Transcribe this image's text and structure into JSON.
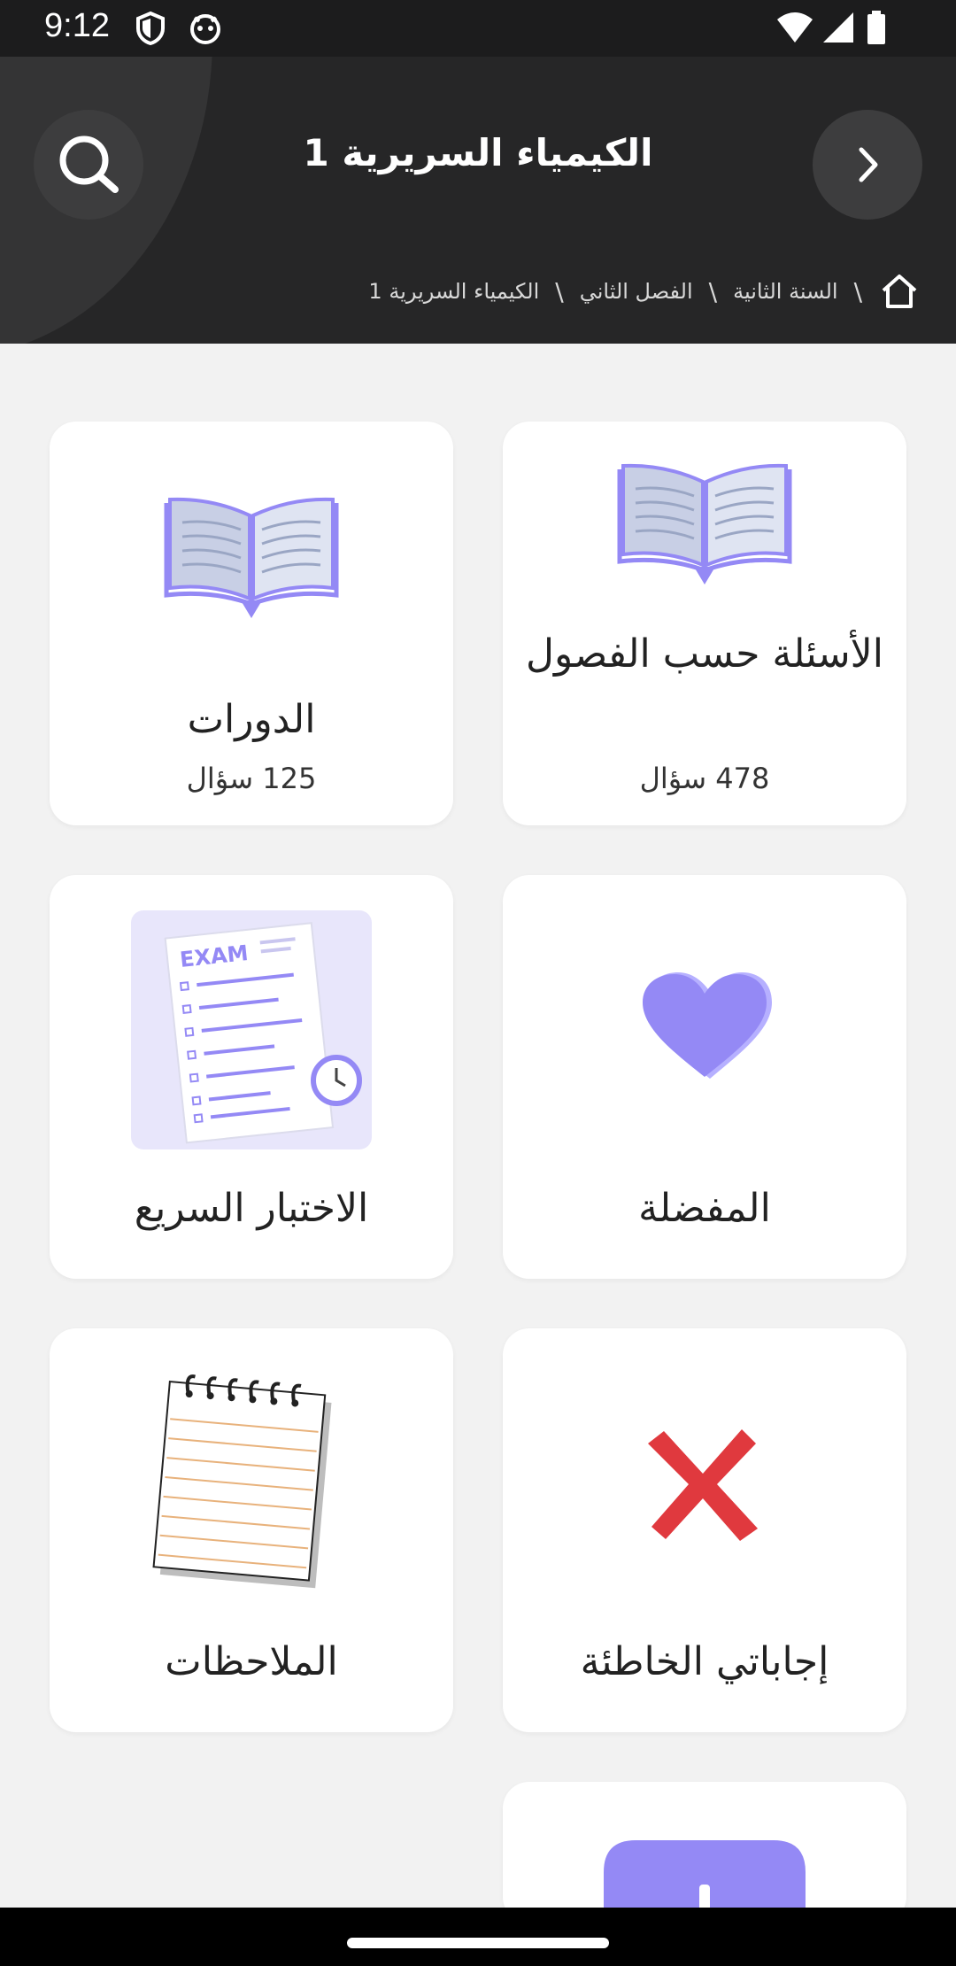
{
  "status_bar": {
    "time": "9:12"
  },
  "header": {
    "title": "الكيمياء السريرية 1",
    "breadcrumb": [
      "السنة الثانية",
      "الفصل الثاني",
      "الكيمياء السريرية 1"
    ],
    "separator": "\\"
  },
  "cards": [
    {
      "title": "الأسئلة حسب الفصول",
      "count": "478 سؤال",
      "icon": "open-book-icon"
    },
    {
      "title": "الدورات",
      "count": "125 سؤال",
      "icon": "open-book-icon"
    },
    {
      "title": "المفضلة",
      "icon": "heart-icon"
    },
    {
      "title": "الاختبار السريع",
      "icon": "exam-sheet-icon",
      "exam_label": "EXAM"
    },
    {
      "title": "إجاباتي الخاطئة",
      "icon": "red-x-icon"
    },
    {
      "title": "الملاحظات",
      "icon": "notepad-icon"
    }
  ],
  "colors": {
    "accent": "#9489f5",
    "header_bg": "#262627",
    "wrong_red": "#e0393e"
  }
}
